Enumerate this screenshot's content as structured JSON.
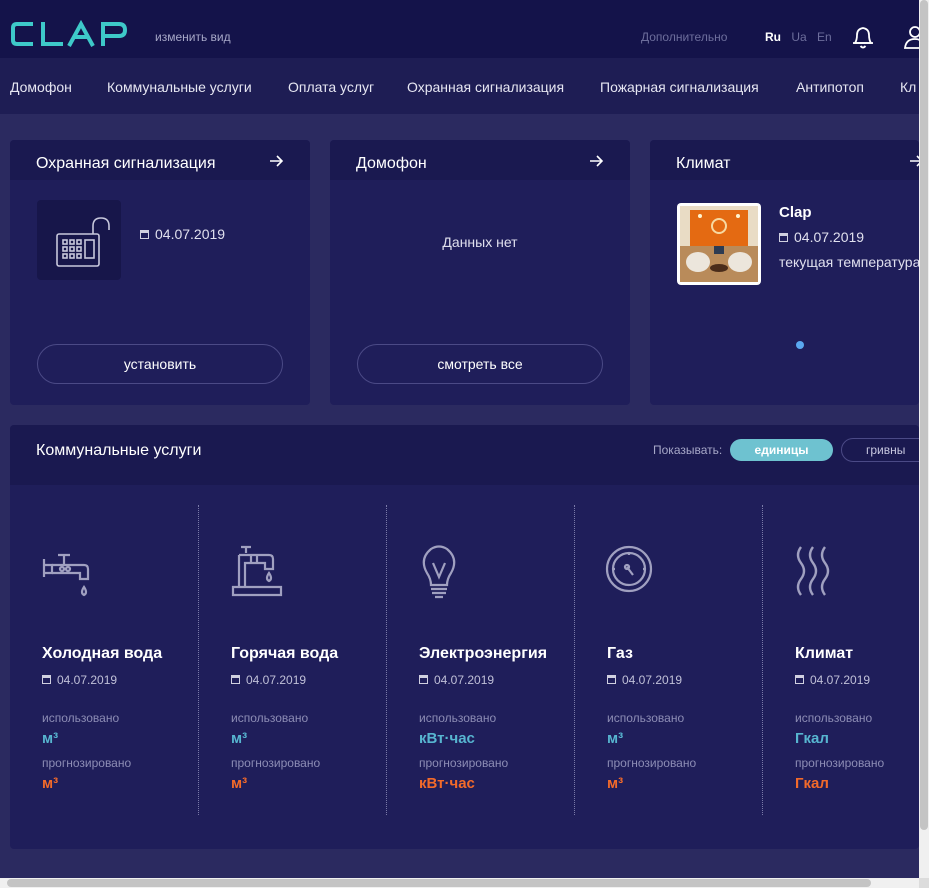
{
  "header": {
    "logo_text": "CLAP",
    "change_view": "изменить вид",
    "more": "Дополнительно",
    "languages": [
      "Ru",
      "Ua",
      "En"
    ],
    "active_language": "Ru",
    "accent_color": "#3ec9c9"
  },
  "nav": {
    "items": [
      "Домофон",
      "Коммунальные услуги",
      "Оплата услуг",
      "Охранная сигнализация",
      "Пожарная сигнализация",
      "Антипотоп",
      "Кл"
    ]
  },
  "cards": {
    "security": {
      "title": "Охранная сигнализация",
      "date": "04.07.2019",
      "button": "установить",
      "icon": "keypad-lock-icon"
    },
    "intercom": {
      "title": "Домофон",
      "empty": "Данных нет",
      "button": "смотреть все"
    },
    "climate": {
      "title": "Климат",
      "item_title": "Clap",
      "date": "04.07.2019",
      "subtitle": "текущая температура",
      "image": "room-interior-photo"
    }
  },
  "utilities": {
    "title": "Коммунальные услуги",
    "show_label": "Показывать:",
    "toggle_units": "единицы",
    "toggle_uah": "гривны",
    "used_label": "использовано",
    "forecast_label": "прогнозировано",
    "used_color": "#57b5d0",
    "forecast_color": "#f26a2a",
    "items": [
      {
        "name": "Холодная вода",
        "date": "04.07.2019",
        "unit": "м³",
        "icon": "cold-water-tap-icon"
      },
      {
        "name": "Горячая вода",
        "date": "04.07.2019",
        "unit": "м³",
        "icon": "hot-water-tap-icon"
      },
      {
        "name": "Электроэнергия",
        "date": "04.07.2019",
        "unit": "кВт·час",
        "icon": "lightbulb-icon"
      },
      {
        "name": "Газ",
        "date": "04.07.2019",
        "unit": "м³",
        "icon": "gas-meter-icon"
      },
      {
        "name": "Климат",
        "date": "04.07.2019",
        "unit": "Гкал",
        "icon": "heat-waves-icon"
      }
    ]
  }
}
